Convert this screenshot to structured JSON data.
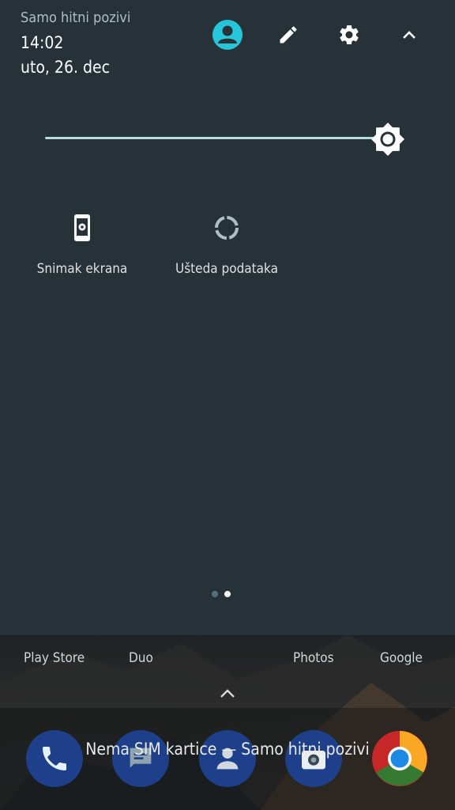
{
  "status": {
    "carrier": "Samo hitni pozivi",
    "time": "14:02",
    "date": "uto, 26. dec"
  },
  "header_icons": [
    "account-icon",
    "edit-icon",
    "settings-icon",
    "collapse-icon"
  ],
  "brightness": {
    "level": 0.99
  },
  "tiles": [
    {
      "label": "Snimak ekrana",
      "icon": "screenshot-icon"
    },
    {
      "label": "Ušteda podataka",
      "icon": "data-saver-icon"
    }
  ],
  "pager": {
    "pages": 2,
    "current": 2
  },
  "home": {
    "apps": [
      "Play Store",
      "Duo",
      "Photos",
      "Google"
    ],
    "dock": [
      "phone-icon",
      "messages-icon",
      "contacts-icon",
      "camera-icon",
      "chrome-icon"
    ],
    "sim_message": "Nema SIM kartice — Samo hitni pozivi"
  },
  "colors": {
    "panel_bg": "#263238",
    "accent": "#26c6da",
    "slider": "#b2dfdb"
  }
}
